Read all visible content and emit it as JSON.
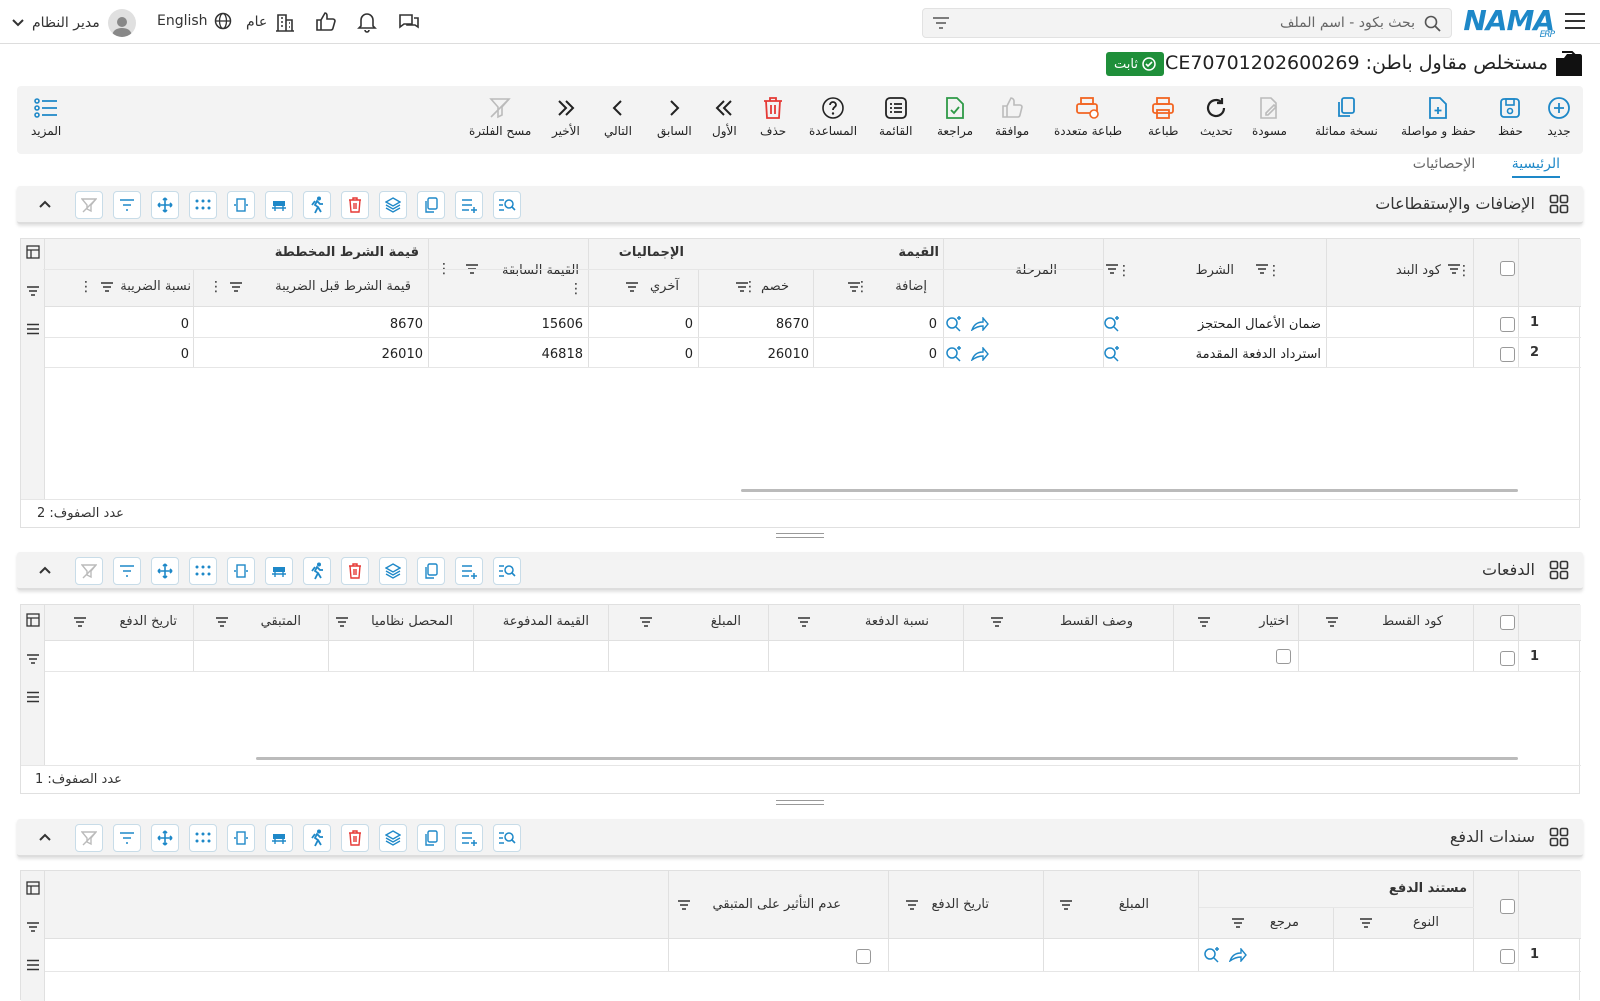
{
  "topbar": {
    "search_placeholder": "بحث بكود - اسم الملف",
    "logo_text": "NAMA",
    "logo_sub": "ERP",
    "user_name": "مدير النظام",
    "language": "English",
    "branch": "عام"
  },
  "document": {
    "title": "مستخلص مقاول باطن: CCE70701202600269",
    "status": "ثابت",
    "status_color": "#1f8f3a"
  },
  "toolbar": {
    "new": "جديد",
    "save": "حفظ",
    "save_continue": "حفظ و مواصلة",
    "copy": "نسخة مماثلة",
    "draft": "مسودة",
    "refresh": "تحديث",
    "print": "طباعة",
    "multi_print": "طباعة متعددة",
    "approve": "موافقة",
    "review": "مراجعة",
    "list": "القائمة",
    "help": "المساعدة",
    "delete": "حذف",
    "first": "الأول",
    "previous": "السابق",
    "next": "التالي",
    "last": "الأخير",
    "clear_filter": "مسح الفلترة",
    "more": "المزيد"
  },
  "tabs": [
    "الرئيسية",
    "الإحصائيات"
  ],
  "accent_color": "#1e88c8",
  "sections": {
    "additions": {
      "title": "الإضافات والإستقطاعات",
      "headers": {
        "item_code": "كود البند",
        "condition": "الشرط",
        "stage": "المرحلة",
        "value_group": "القيمة",
        "addition": "إضافة",
        "discount": "خصم",
        "totals_group": "الإجماليات",
        "other": "آخري",
        "prev_value": "القيمة السابقة",
        "planned_group": "قيمة الشرط المخططة",
        "before_tax": "قيمة الشرط قبل الضريبة",
        "tax_rate": "نسبة الضريبة"
      },
      "rows": [
        {
          "num": "1",
          "condition": "ضمان الأعمال المحتجز",
          "addition": "0",
          "discount": "8670",
          "other": "0",
          "prev_value": "15606",
          "before_tax": "8670",
          "tax_rate": "0"
        },
        {
          "num": "2",
          "condition": "استرداد الدفعة المقدمة",
          "addition": "0",
          "discount": "26010",
          "other": "0",
          "prev_value": "46818",
          "before_tax": "26010",
          "tax_rate": "0"
        }
      ],
      "row_count": "عدد الصفوف: 2"
    },
    "payments": {
      "title": "الدفعات",
      "headers": {
        "installment_code": "كود القسط",
        "choice": "اختيار",
        "installment_desc": "وصف القسط",
        "payment_rate": "نسبة الدفعة",
        "amount": "المبلغ",
        "paid_value": "القيمة المدفوعة",
        "collected": "المحصل نظاميا",
        "remaining": "المتبقي",
        "payment_date": "تاريخ الدفع"
      },
      "rows": [
        {
          "num": "1"
        }
      ],
      "row_count": "عدد الصفوف: 1"
    },
    "vouchers": {
      "title": "سندات الدفع",
      "headers": {
        "doc_group": "مستند الدفع",
        "type": "النوع",
        "reference": "مرجع",
        "amount": "المبلغ",
        "payment_date": "تاريخ الدفع",
        "no_effect": "عدم التأثير على المتبقي"
      },
      "rows": [
        {
          "num": "1"
        }
      ]
    }
  }
}
